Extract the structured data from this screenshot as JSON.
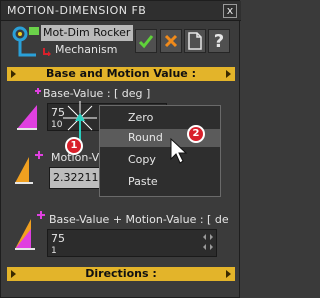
{
  "window": {
    "title": "MOTION-DIMENSION FB",
    "close_glyph": "x"
  },
  "header": {
    "feature_name": "Mot-Dim Rocker",
    "mechanism_label": "Mechanism",
    "toolbar": {
      "ok_icon": "check-icon",
      "cancel_icon": "cross-icon",
      "new_icon": "document-icon",
      "help_label": "?"
    }
  },
  "sections": {
    "base_motion": "Base and Motion Value :",
    "directions": "Directions :"
  },
  "base_value": {
    "label": "Base-Value : [ deg ]",
    "value": "75",
    "step": "10"
  },
  "motion_value": {
    "label": "Motion-V",
    "value": "2.32211"
  },
  "sum_value": {
    "label": "Base-Value + Motion-Value : [ de",
    "value": "75",
    "step": "1"
  },
  "context_menu": {
    "items": [
      "Zero",
      "Round",
      "Copy",
      "Paste"
    ],
    "highlighted_index": 1
  },
  "callouts": {
    "first": "1",
    "second": "2"
  },
  "colors": {
    "accent": "#e3b42a",
    "callout": "#d8202b",
    "icon_magenta": "#e040e0",
    "ok_green": "#5fd23a",
    "cancel_orange": "#f08a1a"
  }
}
